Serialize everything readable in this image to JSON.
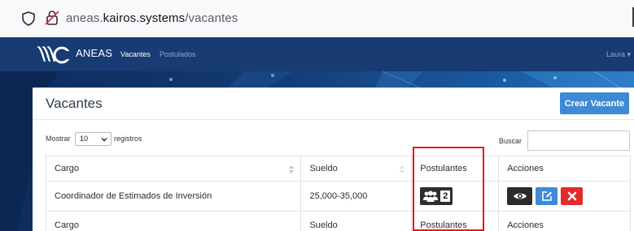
{
  "browser": {
    "url_prefix": "aneas.",
    "url_host": "kairos.systems",
    "url_path": "/vacantes"
  },
  "navbar": {
    "brand": "ANEAS",
    "links": [
      "Vacantes",
      "Postulados"
    ],
    "user": "Laura"
  },
  "page": {
    "title": "Vacantes",
    "create_button": "Crear Vacante"
  },
  "table_controls": {
    "show_label": "Mostrar",
    "page_length": "10",
    "records_label": "registros",
    "search_label": "Buscar",
    "search_value": ""
  },
  "table": {
    "headers": [
      "Cargo",
      "Sueldo",
      "Postulantes",
      "Acciones"
    ],
    "rows": [
      {
        "cargo": "Coordinador de Estimados de Inversión",
        "sueldo": "25,000-35,000",
        "postulantes": "2"
      }
    ],
    "footers": [
      "Cargo",
      "Sueldo",
      "Postulantes",
      "Acciones"
    ]
  },
  "icons": {
    "security": "shield-icon",
    "tracking": "tracking-protection-icon",
    "applicants": "users-icon",
    "view": "eye-icon",
    "edit": "edit-icon",
    "delete": "close-icon"
  },
  "colors": {
    "navbar": "#173b72",
    "primary": "#3f8ad6",
    "danger": "#e32b2b",
    "dark": "#2e2e2e",
    "highlight": "#e8161a"
  }
}
